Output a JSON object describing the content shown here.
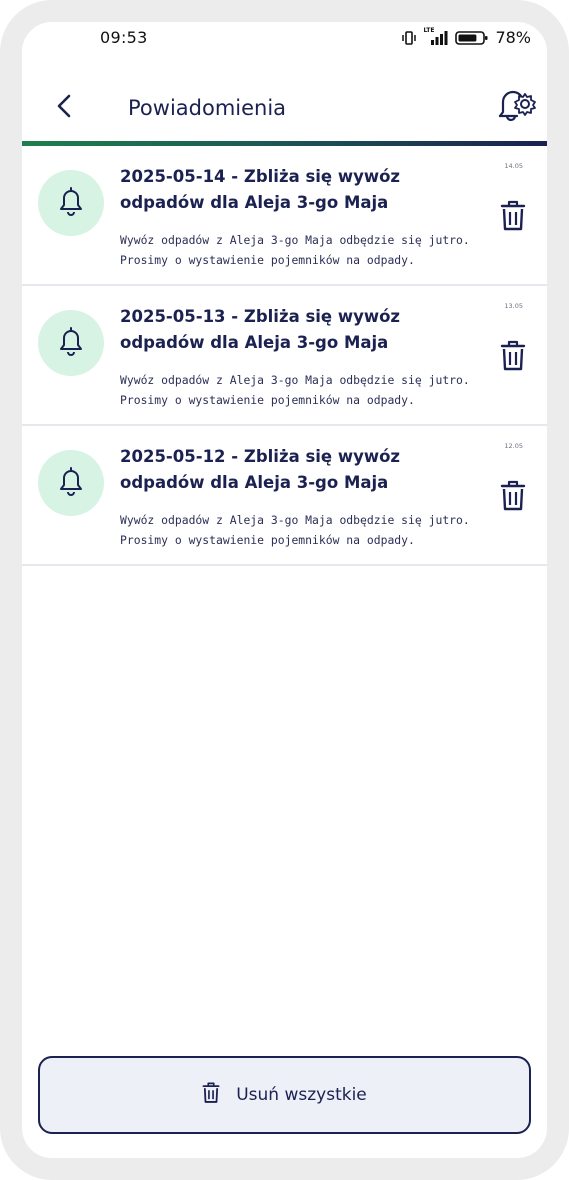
{
  "status_bar": {
    "time": "09:53",
    "network_label": "LTE",
    "battery": "78%",
    "battery_level": 0.78
  },
  "header": {
    "title": "Powiadomienia",
    "back_icon": "chevron-left-icon",
    "settings_icon": "gear-icon"
  },
  "colors": {
    "primary": "#1b2150",
    "accent_green": "#1f7f4c",
    "icon_circle": "#d6f3e4",
    "button_bg": "#eef0f7"
  },
  "notifications": [
    {
      "title": "2025-05-14 - Zbliża się wywóz odpadów dla Aleja 3-go Maja",
      "body": "Wywóz odpadów z Aleja 3-go Maja odbędzie się jutro. Prosimy o wystawienie pojemników na odpady.",
      "date": "14.05"
    },
    {
      "title": "2025-05-13 - Zbliża się wywóz odpadów dla Aleja 3-go Maja",
      "body": "Wywóz odpadów z Aleja 3-go Maja odbędzie się jutro. Prosimy o wystawienie pojemników na odpady.",
      "date": "13.05"
    },
    {
      "title": "2025-05-12 - Zbliża się wywóz odpadów dla Aleja 3-go Maja",
      "body": "Wywóz odpadów z Aleja 3-go Maja odbędzie się jutro. Prosimy o wystawienie pojemników na odpady.",
      "date": "12.05"
    }
  ],
  "footer": {
    "delete_all_label": "Usuń wszystkie"
  }
}
